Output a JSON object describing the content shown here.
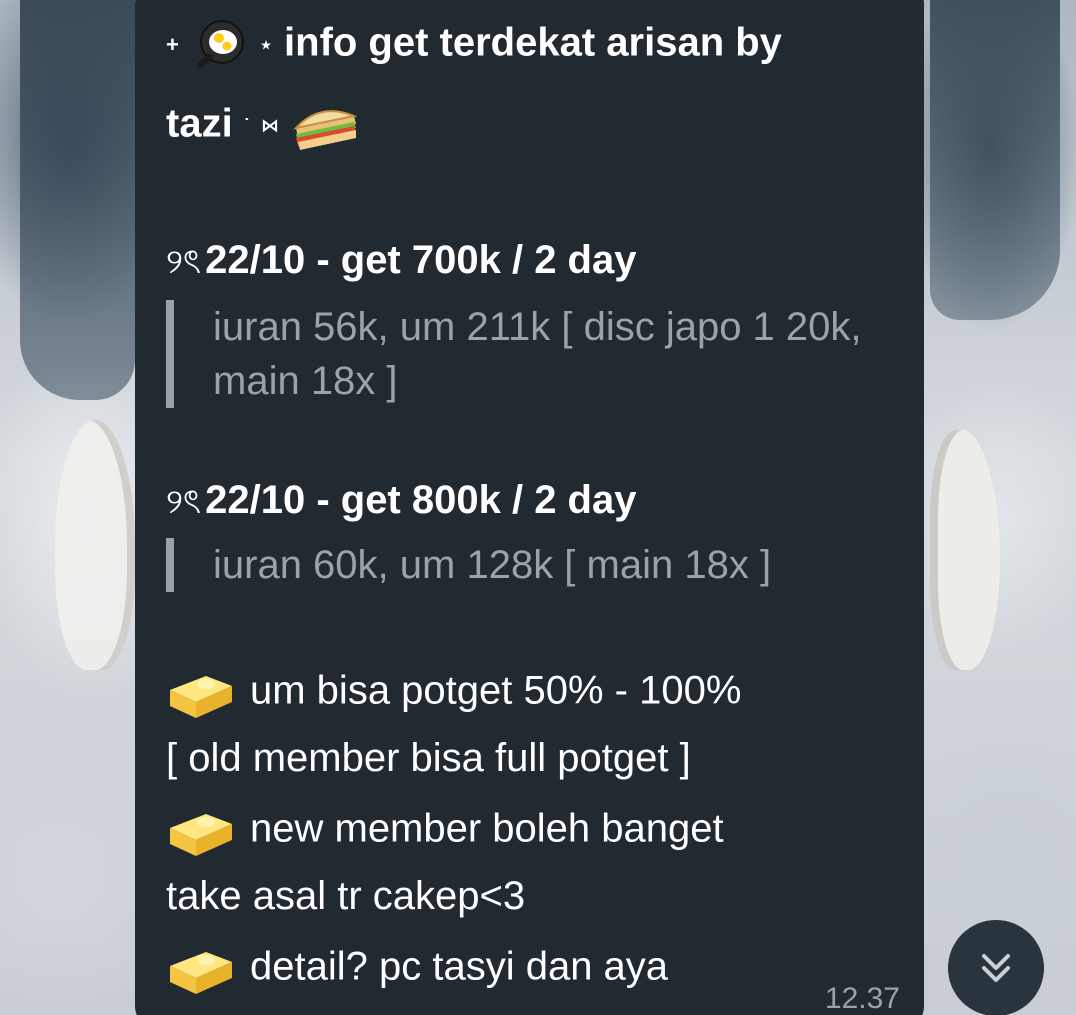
{
  "message": {
    "title_line1": "info get terdekat arisan by",
    "title_line2": "tazi",
    "title_prefix_deco": "+",
    "title_star_deco": "⋆",
    "title_dot_deco": "˙",
    "title_bowtie_deco": "⋈",
    "offers": [
      {
        "prefix": "୨ৎ",
        "heading": "22/10 - get 700k / 2 day",
        "detail": "iuran 56k, um 211k [ disc japo 1 20k, main 18x ]"
      },
      {
        "prefix": "୨ৎ",
        "heading": "22/10 - get 800k / 2 day",
        "detail": "iuran 60k, um 128k [ main 18x ]"
      }
    ],
    "notes": {
      "line1": "um bisa potget 50% - 100%",
      "line2": "[ old member bisa full potget ]",
      "line3": "new member boleh banget",
      "line4": "take asal tr cakep<3",
      "line5": "detail? pc tasyi dan aya"
    },
    "time": "12.37"
  },
  "icons": {
    "title_icon_1": "frying-pan-egg-icon",
    "title_icon_2": "sandwich-icon",
    "bullet_icon": "butter-icon",
    "scroll_icon": "double-chevron-down-icon"
  },
  "colors": {
    "bubble_bg": "#212a31",
    "quote_text": "#9ba2a8",
    "text": "#ffffff",
    "scroll_button_bg": "#2a343c"
  }
}
